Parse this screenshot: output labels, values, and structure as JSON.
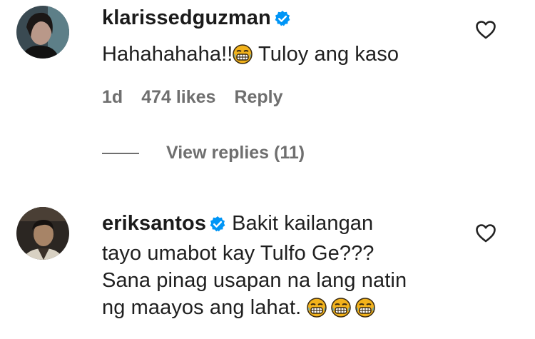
{
  "comments": [
    {
      "username": "klarissedguzman",
      "verified": true,
      "text": "Hahahahaha!!",
      "text_after_emoji": " Tuloy ang kaso",
      "emoji": "grimacing-tears-emoji",
      "age": "1d",
      "likes": "474 likes",
      "reply_label": "Reply",
      "view_replies": "View replies (11)",
      "like_icon": "heart-outline-icon"
    },
    {
      "username": "eriksantos",
      "verified": true,
      "lines": [
        "Bakit kailangan",
        "tayo umabot kay Tulfo Ge???",
        "Sana pinag usapan na lang natin",
        "ng maayos ang lahat."
      ],
      "emoji": "grimacing-tears-emoji",
      "emoji_count": 3,
      "like_icon": "heart-outline-icon"
    }
  ],
  "colors": {
    "text": "#1b1b1b",
    "secondary": "#6f6f6f",
    "verified_blue": "#0095f6"
  }
}
